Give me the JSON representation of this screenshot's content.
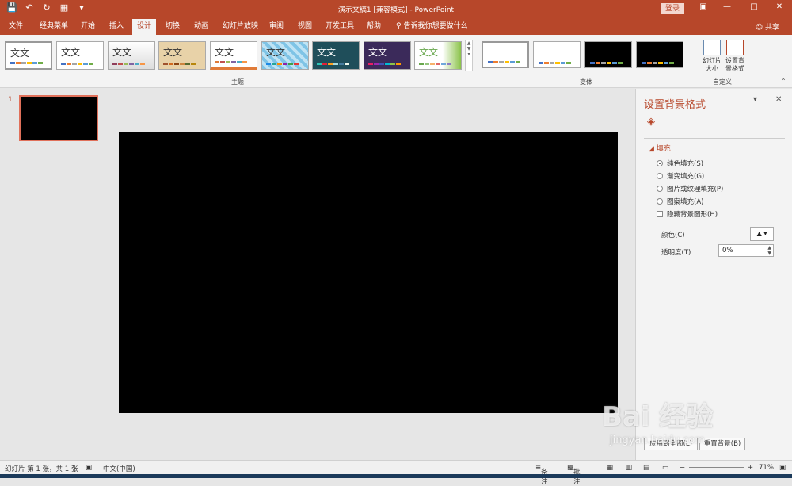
{
  "window": {
    "title": "演示文稿1 [兼容模式] - PowerPoint",
    "login": "登录",
    "share": "共享"
  },
  "colors": {
    "accent": "#b7472a",
    "slide_bg": "#000000",
    "ribbon": "#f3f3f3"
  },
  "tabs": [
    {
      "label": "文件"
    },
    {
      "label": "经典菜单"
    },
    {
      "label": "开始"
    },
    {
      "label": "插入"
    },
    {
      "label": "设计"
    },
    {
      "label": "切换"
    },
    {
      "label": "动画"
    },
    {
      "label": "幻灯片放映"
    },
    {
      "label": "审阅"
    },
    {
      "label": "视图"
    },
    {
      "label": "开发工具"
    },
    {
      "label": "帮助"
    },
    {
      "label": "告诉我你想要做什么"
    }
  ],
  "ribbon": {
    "themes_group": "主题",
    "variants_group": "变体",
    "custom_group": "自定义",
    "theme_text": "文文",
    "slide_size": "幻灯片\n大小",
    "format_bg": "设置背\n景格式"
  },
  "thumbnails": {
    "slide_number": "1"
  },
  "pane": {
    "title": "设置背景格式",
    "section": "填充",
    "options": [
      {
        "label": "纯色填充(S)",
        "selected": true
      },
      {
        "label": "渐变填充(G)",
        "selected": false
      },
      {
        "label": "图片或纹理填充(P)",
        "selected": false
      },
      {
        "label": "图案填充(A)",
        "selected": false
      }
    ],
    "hide_bg": "隐藏背景图形(H)",
    "color_label": "颜色(C)",
    "transparency_label": "透明度(T)",
    "transparency_value": "0%",
    "apply_all": "应用到全部(L)",
    "reset_bg": "重置背景(B)"
  },
  "status": {
    "slide_info": "幻灯片 第 1 张，共 1 张",
    "language": "中文(中国)",
    "notes": "备注",
    "comments": "批注",
    "zoom": "71%"
  },
  "watermark": {
    "brand": "Bai 经验",
    "url": "jingyan.baidu.com"
  }
}
